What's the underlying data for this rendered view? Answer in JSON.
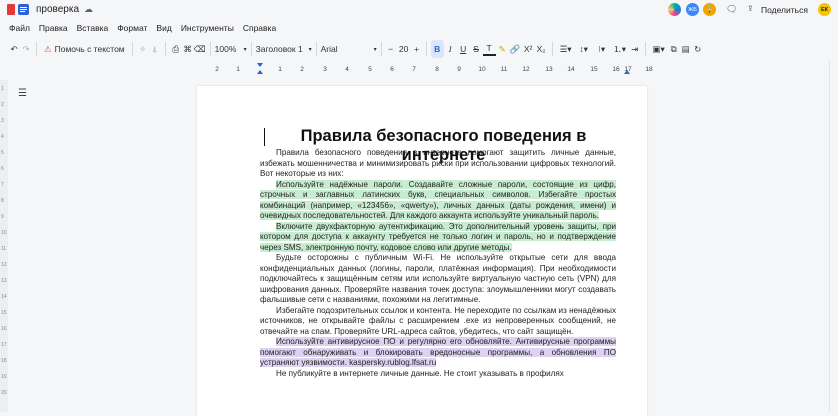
{
  "document": {
    "name": "проверка",
    "title": "Правила безопасного поведения в интернете",
    "paragraphs": [
      {
        "text": "Правила безопасного поведения в интернете помогают защитить личные данные, избежать мошенничества и минимизировать риски при использовании цифровых технологий. Вот некоторые из них:",
        "highlight": ""
      },
      {
        "text": "Используйте надёжные пароли. Создавайте сложные пароли, состоящие из цифр, строчных и заглавных латинских букв, специальных символов. Избегайте простых комбинаций (например, «123456», «qwerty»), личных данных (даты рождения, имени) и очевидных последовательностей. Для каждого аккаунта используйте уникальный пароль.",
        "highlight": "green"
      },
      {
        "text": "Включите двухфакторную аутентификацию. Это дополнительный уровень защиты, при котором для доступа к аккаунту требуется не только логин и пароль, но и подтверждение через SMS, электронную почту, кодовое слово или другие методы.",
        "highlight": "green"
      },
      {
        "text": "Будьте осторожны с публичным Wi-Fi. Не используйте открытые сети для ввода конфиденциальных данных (логины, пароли, платёжная информация). При необходимости подключайтесь к защищённым сетям или используйте виртуальную частную сеть (VPN) для шифрования данных. Проверяйте названия точек доступа: злоумышленники могут создавать фальшивые сети с названиями, похожими на легитимные.",
        "highlight": ""
      },
      {
        "text": "Избегайте подозрительных ссылок и контента. Не переходите по ссылкам из ненадёжных источников, не открывайте файлы с расширением .exe из непроверенных сообщений, не отвечайте на спам. Проверяйте URL-адреса сайтов, убедитесь, что сайт защищён.",
        "highlight": ""
      },
      {
        "text": "Используйте антивирусное ПО и регулярно его обновляйте. Антивирусные программы помогают обнаруживать и блокировать вредоносные программы, а обновления ПО устраняют уязвимости. kaspersky.rublog.lfsat.ru",
        "highlight": "purple"
      },
      {
        "text": "Не публикуйте в интернете личные данные. Не стоит указывать в профилях",
        "highlight": "partial"
      }
    ]
  },
  "menu": [
    "Файл",
    "Правка",
    "Вставка",
    "Формат",
    "Вид",
    "Инструменты",
    "Справка"
  ],
  "toolbar": {
    "help_label": "Помочь с текстом",
    "zoom": "100%",
    "style": "Заголовок 1",
    "font": "Arial",
    "size": "20",
    "share_label": "Поделиться"
  },
  "avatars": [
    "ЖБ",
    "ЕК"
  ],
  "ruler": [
    "2",
    "1",
    "1",
    "2",
    "3",
    "4",
    "5",
    "6",
    "7",
    "8",
    "9",
    "10",
    "11",
    "12",
    "13",
    "14",
    "15",
    "16",
    "17",
    "18"
  ],
  "gutter_numbers": [
    "1",
    "2",
    "3",
    "4",
    "5",
    "6",
    "7",
    "8",
    "9",
    "10",
    "11",
    "12",
    "13",
    "14",
    "15",
    "16",
    "17",
    "18",
    "19",
    "20"
  ],
  "colors": {
    "accent": "#2b62d9",
    "highlight_green": "#c8ecd0",
    "highlight_purple": "#ddd3f0"
  }
}
